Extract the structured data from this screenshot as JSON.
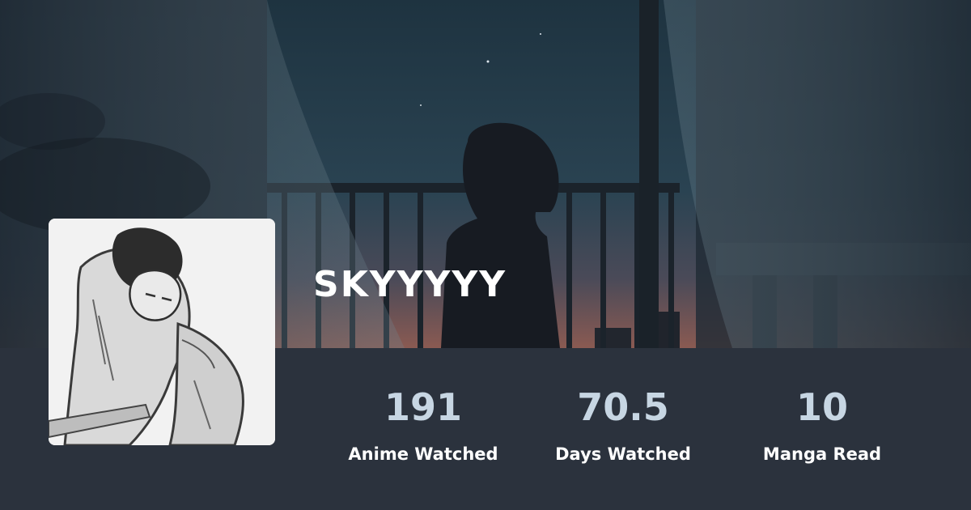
{
  "profile": {
    "username": "SKYYYYY"
  },
  "stats": [
    {
      "value": "191",
      "label": "Anime Watched"
    },
    {
      "value": "70.5",
      "label": "Days Watched"
    },
    {
      "value": "10",
      "label": "Manga Read"
    }
  ],
  "colors": {
    "band": "#2b323d",
    "stat_value": "#c7d6e3",
    "label": "#ffffff"
  }
}
